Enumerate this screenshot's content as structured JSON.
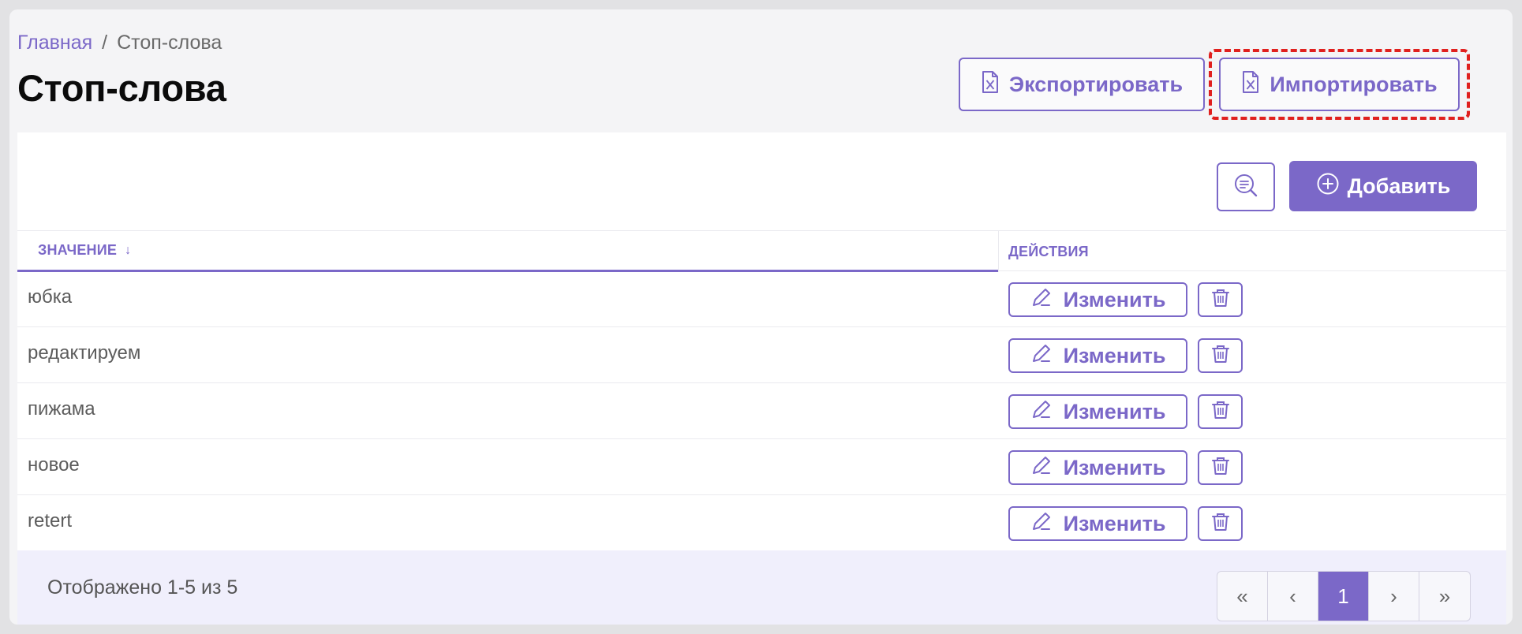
{
  "breadcrumb": {
    "home": "Главная",
    "separator": "/",
    "current": "Стоп-слова"
  },
  "page_title": "Стоп-слова",
  "header_actions": {
    "export_label": "Экспортировать",
    "import_label": "Импортировать"
  },
  "toolbar": {
    "add_label": "Добавить",
    "search_icon": "search-list-icon",
    "add_icon": "plus-circle-icon"
  },
  "table": {
    "columns": {
      "value": "ЗНАЧЕНИЕ",
      "value_sort": "↓",
      "actions": "ДЕЙСТВИЯ"
    },
    "edit_label": "Изменить",
    "rows": [
      {
        "value": "юбка"
      },
      {
        "value": "редактируем"
      },
      {
        "value": "пижама"
      },
      {
        "value": "новое"
      },
      {
        "value": "retert"
      }
    ]
  },
  "pagination": {
    "summary": "Отображено 1-5 из 5",
    "first": "«",
    "prev": "‹",
    "current_page": "1",
    "next": "›",
    "last": "»"
  },
  "colors": {
    "accent": "#7b68c8",
    "highlight": "#e0201e",
    "background": "#f4f4f6"
  }
}
